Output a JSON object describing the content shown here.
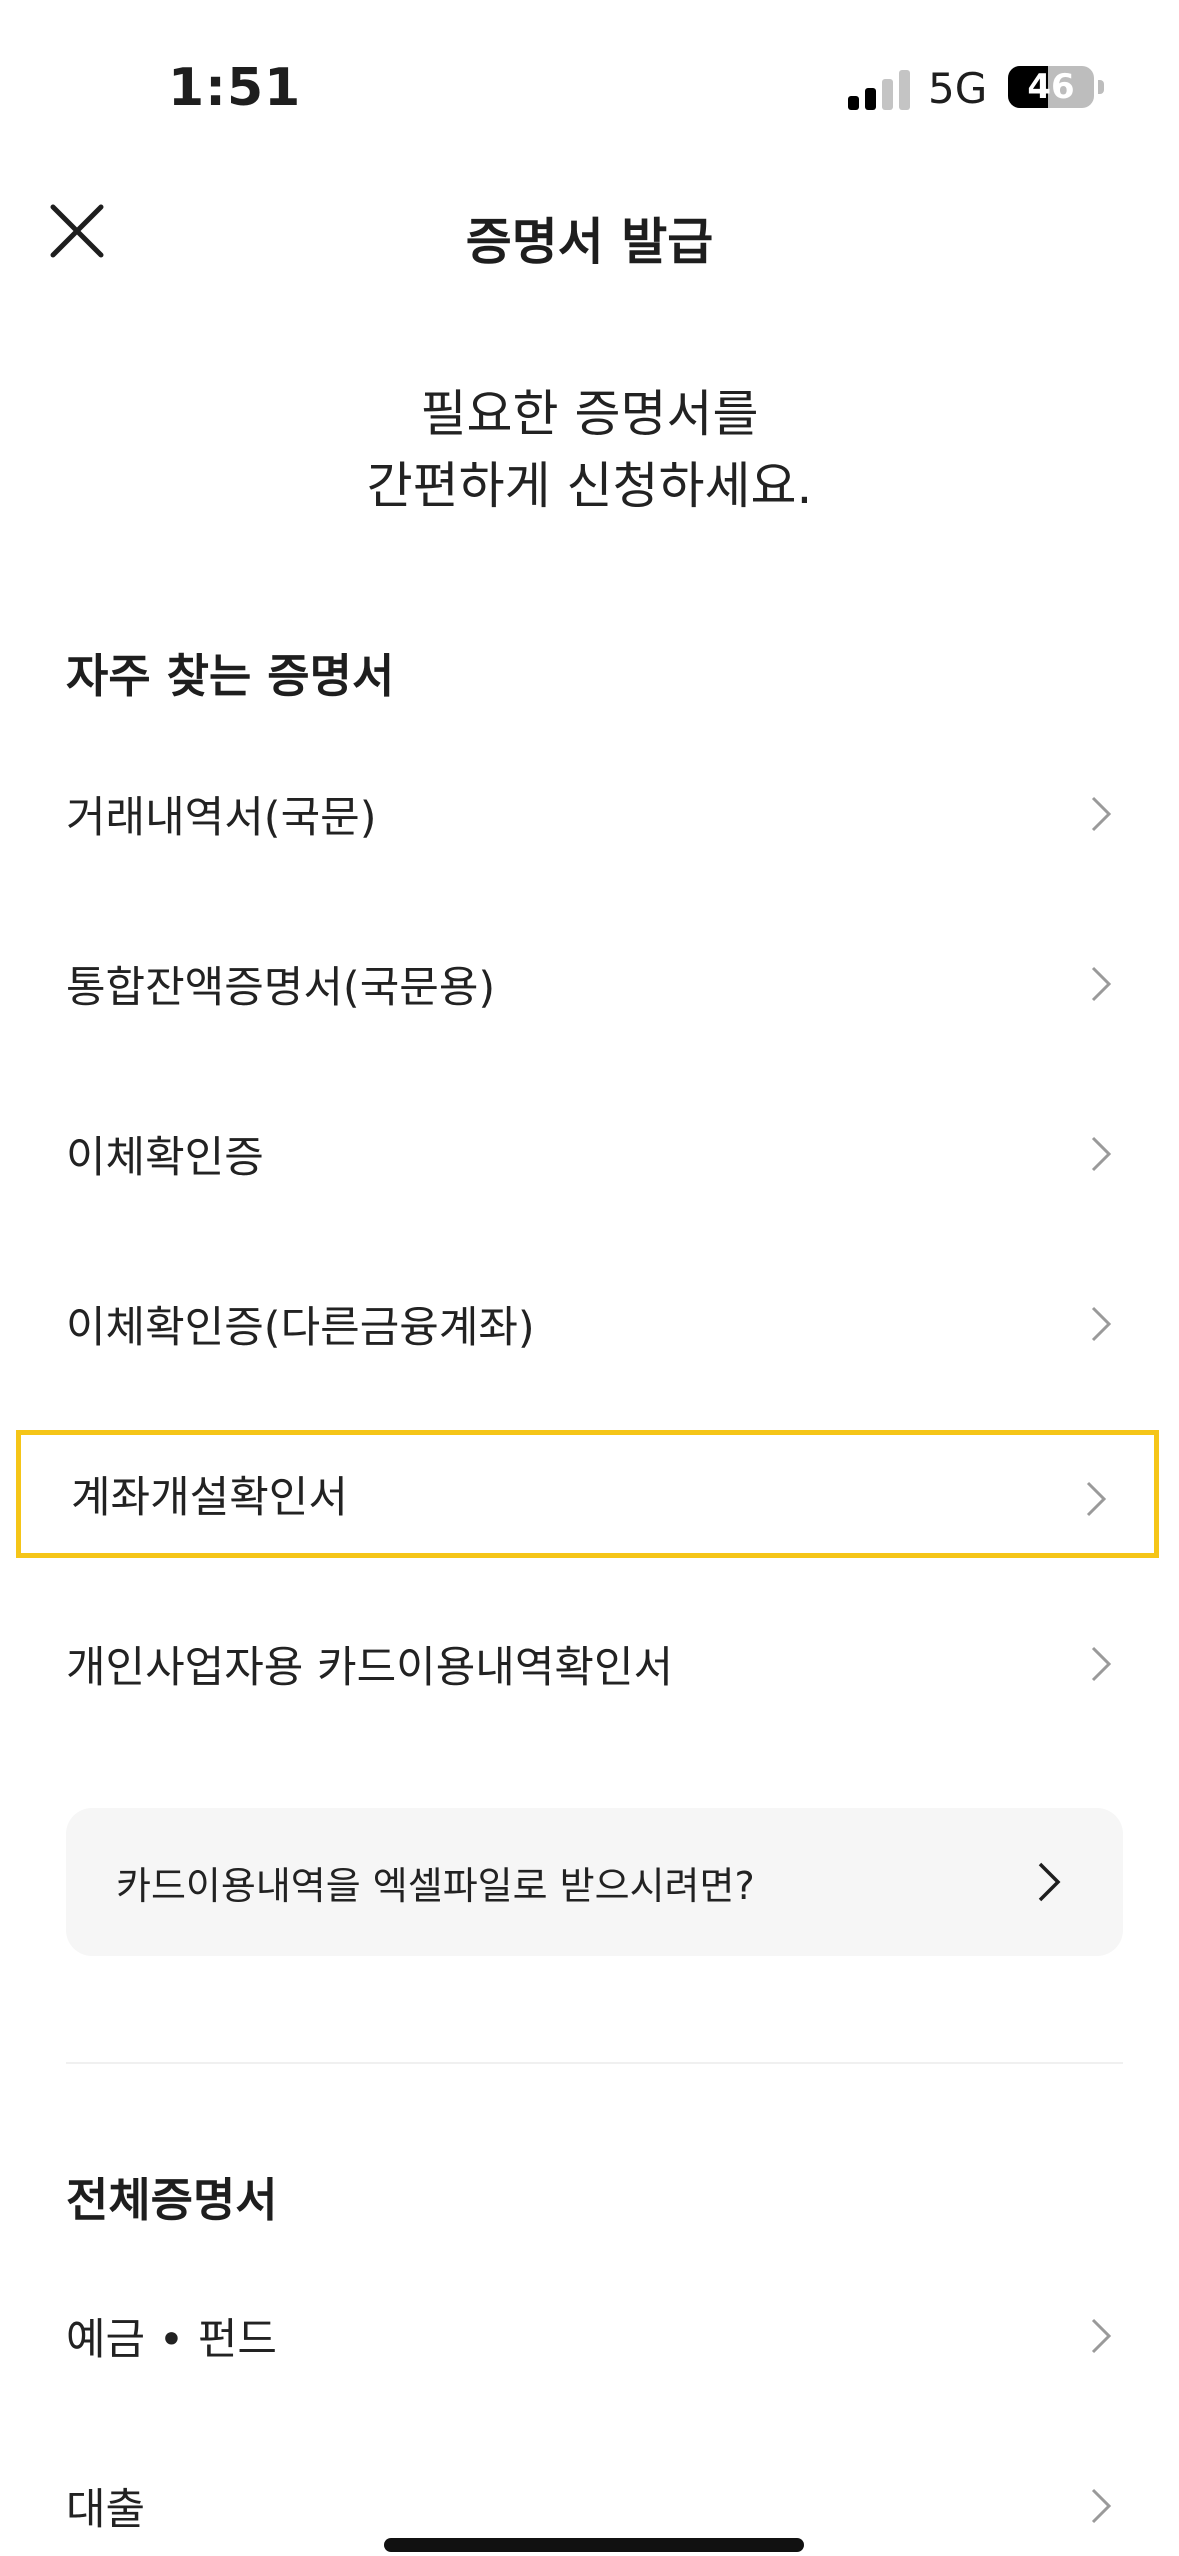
{
  "status_bar": {
    "time": "1:51",
    "network": "5G",
    "battery": "46",
    "battery_level_percent": 46
  },
  "header": {
    "title": "증명서 발급"
  },
  "intro": {
    "line1": "필요한 증명서를",
    "line2": "간편하게 신청하세요."
  },
  "frequent": {
    "title": "자주 찾는 증명서",
    "items": [
      {
        "label": "거래내역서(국문)"
      },
      {
        "label": "통합잔액증명서(국문용)"
      },
      {
        "label": "이체확인증"
      },
      {
        "label": "이체확인증(다른금융계좌)"
      },
      {
        "label": "계좌개설확인서"
      },
      {
        "label": "개인사업자용 카드이용내역확인서"
      }
    ]
  },
  "info_box": {
    "label": "카드이용내역을 엑셀파일로 받으시려면?"
  },
  "all": {
    "title": "전체증명서",
    "items": [
      {
        "label": "예금 • 펀드"
      },
      {
        "label": "대출"
      }
    ]
  },
  "colors": {
    "highlight_border": "#f5c518",
    "info_box_bg": "#f6f6f6",
    "chevron": "#9a9a9a"
  }
}
